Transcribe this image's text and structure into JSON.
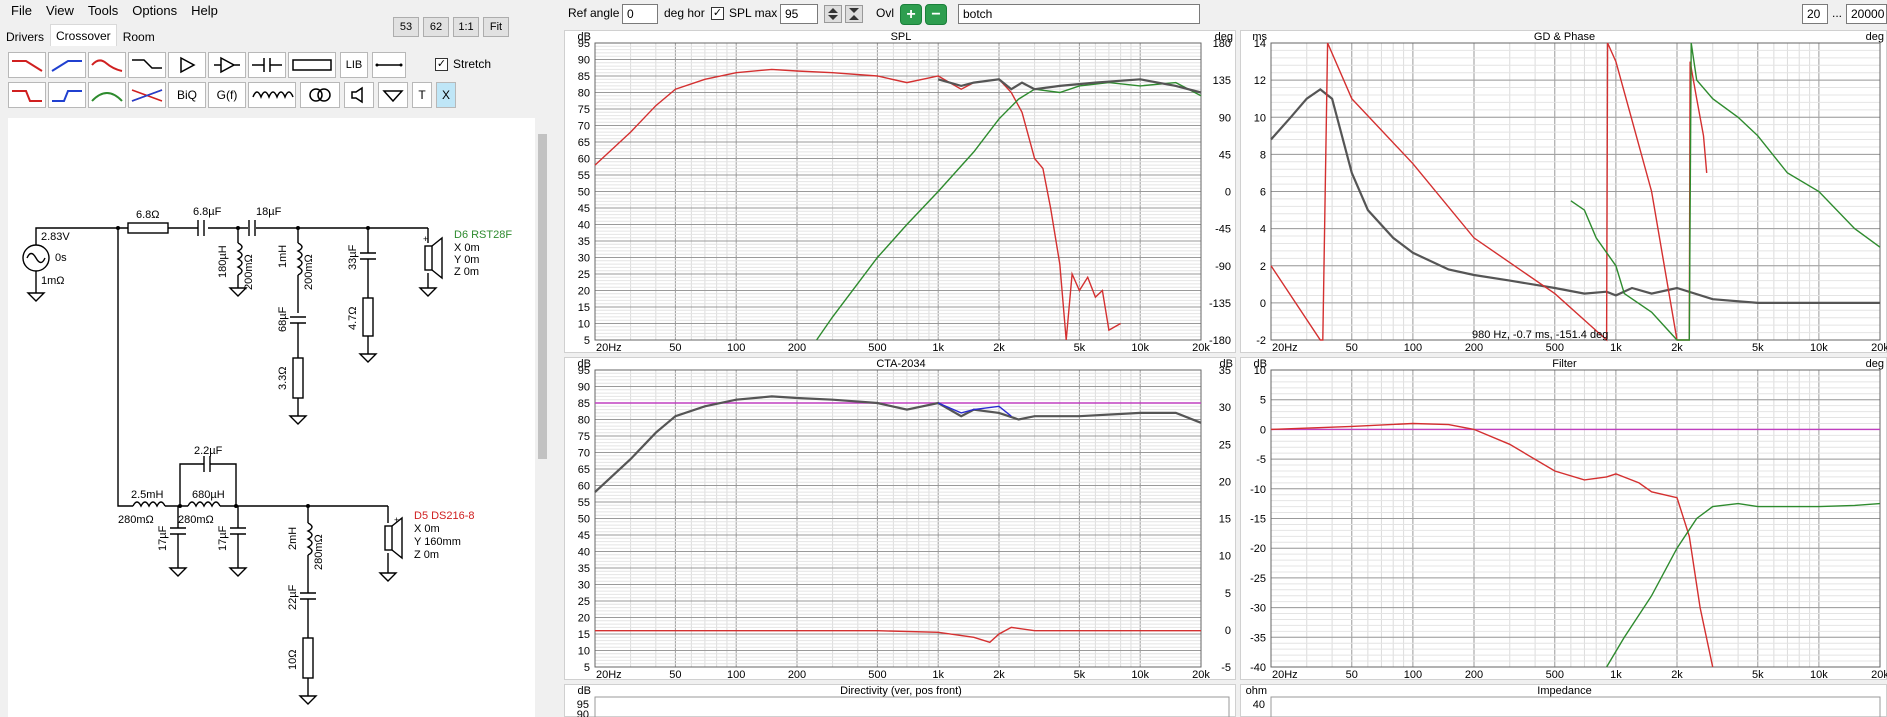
{
  "menu": [
    "File",
    "View",
    "Tools",
    "Options",
    "Help"
  ],
  "zoom": [
    "53",
    "62",
    "1:1",
    "Fit"
  ],
  "tabs": [
    "Drivers",
    "Crossover",
    "Room"
  ],
  "palette": {
    "lib": "LIB",
    "biq": "BiQ",
    "gf": "G(f)",
    "t": "T",
    "x": "X",
    "stretch": "Stretch"
  },
  "toolbar": {
    "ref_angle_label": "Ref angle",
    "ref_angle": "0",
    "deg_hor": "deg hor",
    "spl_max_label": "SPL max",
    "spl_max": "95",
    "ovl": "Ovl",
    "name": "botch",
    "fmin": "20",
    "dots": "...",
    "fmax": "20000"
  },
  "schematic": {
    "source_v": "2.83V",
    "source_t": "0s",
    "source_r": "1mΩ",
    "r1": "6.8Ω",
    "c1": "6.8µF",
    "c2": "18µF",
    "l1": "180µH",
    "l1r": "200mΩ",
    "l2": "1mH",
    "l2r": "200mΩ",
    "c3": "33µF",
    "r2": "4.7Ω",
    "c4": "68µF",
    "r3": "3.3Ω",
    "tw_name": "D6 RST28F",
    "tw_x": "X 0m",
    "tw_y": "Y 0m",
    "tw_z": "Z 0m",
    "c5": "2.2µF",
    "l3": "2.5mH",
    "l3r": "280mΩ",
    "l4": "680µH",
    "l4r": "280mΩ",
    "c6": "17µF",
    "c7": "17µF",
    "l5": "2mH",
    "l5r": "280mΩ",
    "c8": "22µF",
    "r4": "10Ω",
    "wf_name": "D5 DS216-8",
    "wf_x": "X 0m",
    "wf_y": "Y 160mm",
    "wf_z": "Z 0m"
  },
  "chart_data": [
    {
      "type": "line",
      "title": "SPL",
      "ylabel": "dB",
      "y2label": "deg",
      "yticks": [
        95,
        90,
        85,
        80,
        75,
        70,
        65,
        60,
        55,
        50,
        45,
        40,
        35,
        30,
        25,
        20,
        15,
        10,
        5
      ],
      "y2ticks": [
        180,
        135,
        90,
        45,
        0,
        -45,
        -90,
        -135,
        -180
      ],
      "xticks": [
        "20Hz",
        "50",
        "100",
        "200",
        "500",
        "1k",
        "2k",
        "5k",
        "10k",
        "20k"
      ],
      "ylim": [
        5,
        95
      ],
      "y2lim": [
        -180,
        180
      ],
      "xlim": [
        20,
        20000
      ],
      "series": [
        {
          "color": "#d43030",
          "x": [
            20,
            30,
            40,
            50,
            70,
            100,
            150,
            200,
            300,
            500,
            700,
            1000,
            1300,
            1500,
            2000,
            2300,
            2600,
            3000,
            3300,
            3600,
            4000,
            4300,
            4600,
            5000,
            5500,
            6000,
            6500,
            7000,
            8000
          ],
          "y": [
            58,
            68,
            76,
            81,
            84,
            86,
            87,
            86.5,
            86,
            85,
            83,
            85,
            81,
            83,
            84,
            80,
            74,
            60,
            57,
            45,
            28,
            5,
            25,
            20,
            24,
            18,
            20,
            8,
            10
          ]
        },
        {
          "color": "#2e8b2e",
          "x": [
            250,
            300,
            500,
            700,
            1000,
            1500,
            2000,
            2500,
            3000,
            4000,
            5000,
            7000,
            10000,
            15000,
            20000
          ],
          "y": [
            5,
            12,
            30,
            40,
            50,
            62,
            72,
            78,
            81,
            80,
            82,
            83,
            82,
            83,
            79
          ]
        },
        {
          "color": "#555555",
          "x": [
            1000,
            1300,
            1500,
            2000,
            2300,
            2600,
            3000,
            4000,
            6000,
            10000,
            15000,
            20000
          ],
          "y": [
            84,
            82,
            83,
            84,
            81,
            83,
            81,
            82,
            83,
            84,
            82,
            80
          ]
        }
      ]
    },
    {
      "type": "line",
      "title": "GD & Phase",
      "ylabel": "ms",
      "y2label": "deg",
      "yticks": [
        14,
        12,
        10,
        8,
        6,
        4,
        2,
        0,
        -2
      ],
      "xticks": [
        "20Hz",
        "50",
        "100",
        "200",
        "500",
        "1k",
        "2k",
        "5k",
        "10k",
        "20k"
      ],
      "ylim": [
        -2,
        14
      ],
      "xlim": [
        20,
        20000
      ],
      "readout": "980 Hz, -0.7 ms, -151.4 deg",
      "series": [
        {
          "color": "#555555",
          "x": [
            20,
            25,
            30,
            35,
            40,
            50,
            60,
            80,
            100,
            150,
            200,
            300,
            500,
            700,
            900,
            1000,
            1200,
            1500,
            2000,
            3000,
            5000,
            10000,
            20000
          ],
          "y": [
            8.8,
            10,
            11,
            11.5,
            11,
            7,
            5,
            3.5,
            2.7,
            1.8,
            1.5,
            1.2,
            0.8,
            0.5,
            0.6,
            0.4,
            0.8,
            0.5,
            0.8,
            0.2,
            0,
            0,
            0
          ]
        },
        {
          "color": "#d43030",
          "x": [
            20,
            35,
            36,
            38,
            50,
            100,
            200,
            500,
            900,
            910,
            1000,
            1500,
            2000,
            2300,
            2320,
            2500,
            2700,
            2800
          ],
          "y": [
            2,
            -2,
            -2,
            14,
            11,
            7.5,
            3.5,
            0.5,
            -2,
            14,
            13,
            6,
            -2,
            -2,
            13,
            11,
            9,
            7
          ]
        },
        {
          "color": "#2e8b2e",
          "x": [
            600,
            700,
            800,
            1000,
            1100,
            1500,
            2000,
            2300,
            2350,
            2500,
            3000,
            4000,
            5000,
            7000,
            10000,
            15000,
            20000
          ],
          "y": [
            5.5,
            5,
            3.5,
            2,
            0.5,
            -0.5,
            -2,
            -2,
            14,
            12,
            11,
            10,
            9,
            7,
            6,
            4,
            3
          ]
        }
      ]
    },
    {
      "type": "line",
      "title": "CTA-2034",
      "ylabel": "dB",
      "y2label": "dB",
      "yticks": [
        95,
        90,
        85,
        80,
        75,
        70,
        65,
        60,
        55,
        50,
        45,
        40,
        35,
        30,
        25,
        20,
        15,
        10,
        5
      ],
      "y2ticks": [
        35,
        30,
        25,
        20,
        15,
        10,
        5,
        0,
        -5
      ],
      "xticks": [
        "20Hz",
        "50",
        "100",
        "200",
        "500",
        "1k",
        "2k",
        "5k",
        "10k",
        "20k"
      ],
      "ylim": [
        5,
        95
      ],
      "xlim": [
        20,
        20000
      ],
      "series": [
        {
          "color": "#c040c0",
          "x": [
            20,
            20000
          ],
          "y": [
            85,
            85
          ]
        },
        {
          "color": "#555555",
          "x": [
            20,
            30,
            40,
            50,
            70,
            100,
            150,
            200,
            300,
            500,
            700,
            1000,
            1300,
            1500,
            2000,
            2500,
            3000,
            5000,
            10000,
            15000,
            20000
          ],
          "y": [
            58,
            68,
            76,
            81,
            84,
            86,
            87,
            86.5,
            86,
            85,
            83,
            85,
            81,
            83,
            82,
            80,
            81,
            81,
            82,
            82,
            79
          ]
        },
        {
          "color": "#2b2bd0",
          "x": [
            1000,
            1300,
            1500,
            2000,
            2300
          ],
          "y": [
            85,
            82,
            83,
            84,
            81
          ]
        },
        {
          "color": "#d43030",
          "x": [
            20,
            500,
            1000,
            1500,
            1800,
            2000,
            2300,
            3000,
            20000
          ],
          "y": [
            16,
            16,
            15.5,
            14,
            12.5,
            15,
            17,
            16,
            16
          ]
        }
      ]
    },
    {
      "type": "line",
      "title": "Filter",
      "ylabel": "dB",
      "y2label": "deg",
      "yticks": [
        10,
        5,
        0,
        -5,
        -10,
        -15,
        -20,
        -25,
        -30,
        -35,
        -40
      ],
      "xticks": [
        "20Hz",
        "50",
        "100",
        "200",
        "500",
        "1k",
        "2k",
        "5k",
        "10k",
        "20k"
      ],
      "ylim": [
        -40,
        10
      ],
      "xlim": [
        20,
        20000
      ],
      "series": [
        {
          "color": "#c040c0",
          "x": [
            20,
            20000
          ],
          "y": [
            0,
            0
          ]
        },
        {
          "color": "#d43030",
          "x": [
            20,
            50,
            100,
            150,
            200,
            300,
            500,
            700,
            900,
            1000,
            1300,
            1500,
            2000,
            2300,
            2600,
            3000
          ],
          "y": [
            0,
            0.5,
            1,
            0.8,
            0,
            -2.5,
            -7,
            -8.5,
            -8,
            -7.5,
            -9,
            -10.5,
            -11.5,
            -18,
            -30,
            -40
          ]
        },
        {
          "color": "#2e8b2e",
          "x": [
            900,
            1100,
            1500,
            2000,
            2500,
            3000,
            4000,
            5000,
            7000,
            10000,
            15000,
            20000
          ],
          "y": [
            -40,
            -35,
            -28,
            -20,
            -15,
            -13,
            -12.5,
            -13,
            -13,
            -13,
            -12.8,
            -12.5
          ]
        }
      ]
    },
    {
      "type": "line",
      "title": "Directivity (ver, pos front)",
      "ylabel": "dB",
      "yticks": [
        95,
        90
      ],
      "series": []
    },
    {
      "type": "line",
      "title": "Impedance",
      "ylabel": "ohm",
      "yticks": [
        40
      ],
      "series": []
    }
  ]
}
